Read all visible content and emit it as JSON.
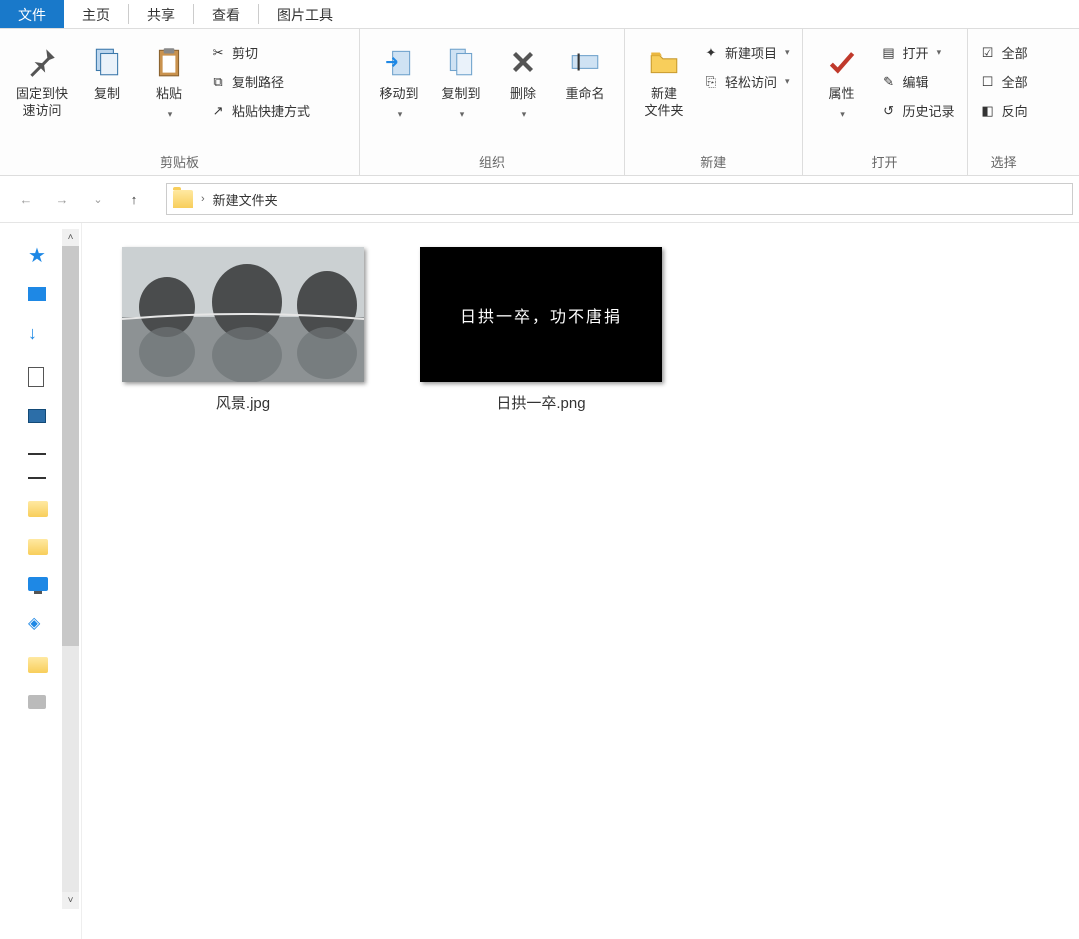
{
  "tabs": {
    "file": "文件",
    "home": "主页",
    "share": "共享",
    "view": "查看",
    "picture_tools": "图片工具"
  },
  "ribbon": {
    "clipboard": {
      "label": "剪贴板",
      "pin": "固定到快\n速访问",
      "copy": "复制",
      "paste": "粘贴",
      "cut": "剪切",
      "copy_path": "复制路径",
      "paste_shortcut": "粘贴快捷方式"
    },
    "organize": {
      "label": "组织",
      "move_to": "移动到",
      "copy_to": "复制到",
      "delete": "删除",
      "rename": "重命名"
    },
    "new": {
      "label": "新建",
      "new_folder": "新建\n文件夹",
      "new_item": "新建项目",
      "easy_access": "轻松访问"
    },
    "open": {
      "label": "打开",
      "properties": "属性",
      "open": "打开",
      "edit": "编辑",
      "history": "历史记录"
    },
    "select": {
      "label": "选择",
      "select_all": "全部",
      "select_none": "全部",
      "invert": "反向"
    }
  },
  "breadcrumb": {
    "current": "新建文件夹",
    "sep": "›"
  },
  "files": [
    {
      "name": "风景.jpg"
    },
    {
      "name": "日拱一卒.png",
      "inner_text": "日拱一卒，功不唐捐"
    }
  ]
}
